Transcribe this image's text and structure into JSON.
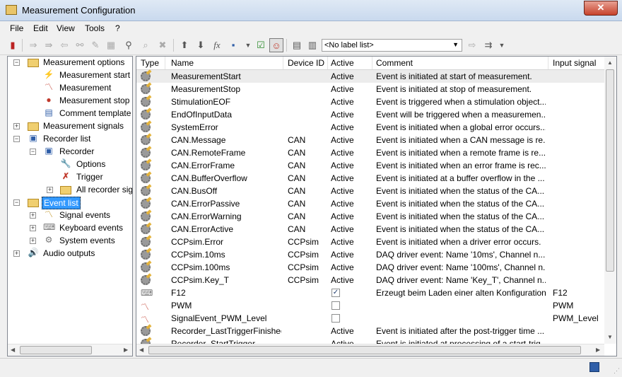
{
  "window": {
    "title": "Measurement Configuration",
    "close_label": "✕"
  },
  "menu": [
    "File",
    "Edit",
    "View",
    "Tools",
    "?"
  ],
  "toolbar": {
    "label_list": "<No label list>"
  },
  "tree": {
    "measurement_options": "Measurement options",
    "measurement_start": "Measurement start",
    "measurement": "Measurement",
    "measurement_stop": "Measurement stop",
    "comment_template": "Comment template",
    "measurement_signals": "Measurement signals",
    "recorder_list": "Recorder list",
    "recorder": "Recorder",
    "options": "Options",
    "trigger": "Trigger",
    "all_recorder_signals": "All recorder sig",
    "event_list": "Event list",
    "signal_events": "Signal events",
    "keyboard_events": "Keyboard events",
    "system_events": "System events",
    "audio_outputs": "Audio outputs"
  },
  "grid": {
    "headers": {
      "type": "Type",
      "name": "Name",
      "device": "Device ID",
      "active": "Active",
      "comment": "Comment",
      "input": "Input signal"
    },
    "rows": [
      {
        "name": "MeasurementStart",
        "device": "",
        "active": "Active",
        "comment": "Event is initiated at start of measurement.",
        "input": "",
        "icon": "gear-icon"
      },
      {
        "name": "MeasurementStop",
        "device": "",
        "active": "Active",
        "comment": "Event is initiated at stop of measurement.",
        "input": "",
        "icon": "gear-icon"
      },
      {
        "name": "StimulationEOF",
        "device": "",
        "active": "Active",
        "comment": "Event is triggered when a stimulation object...",
        "input": "",
        "icon": "gear-icon"
      },
      {
        "name": "EndOfInputData",
        "device": "",
        "active": "Active",
        "comment": "Event will be triggered when a measuremen...",
        "input": "",
        "icon": "gear-icon"
      },
      {
        "name": "SystemError",
        "device": "",
        "active": "Active",
        "comment": "Event is initiated when a global error occurs...",
        "input": "",
        "icon": "gear-icon"
      },
      {
        "name": "CAN.Message",
        "device": "CAN",
        "active": "Active",
        "comment": "Event is initiated when a CAN message is re...",
        "input": "",
        "icon": "gear-icon"
      },
      {
        "name": "CAN.RemoteFrame",
        "device": "CAN",
        "active": "Active",
        "comment": "Event is initiated when a remote frame is re...",
        "input": "",
        "icon": "gear-icon"
      },
      {
        "name": "CAN.ErrorFrame",
        "device": "CAN",
        "active": "Active",
        "comment": "Event is initiated when an error frame is rec...",
        "input": "",
        "icon": "gear-icon"
      },
      {
        "name": "CAN.BufferOverflow",
        "device": "CAN",
        "active": "Active",
        "comment": "Event is initiated at a buffer overflow in the ...",
        "input": "",
        "icon": "gear-icon"
      },
      {
        "name": "CAN.BusOff",
        "device": "CAN",
        "active": "Active",
        "comment": "Event is initiated when the status of the CA...",
        "input": "",
        "icon": "gear-icon"
      },
      {
        "name": "CAN.ErrorPassive",
        "device": "CAN",
        "active": "Active",
        "comment": "Event is initiated when the status of the CA...",
        "input": "",
        "icon": "gear-icon"
      },
      {
        "name": "CAN.ErrorWarning",
        "device": "CAN",
        "active": "Active",
        "comment": "Event is initiated when the status of the CA...",
        "input": "",
        "icon": "gear-icon"
      },
      {
        "name": "CAN.ErrorActive",
        "device": "CAN",
        "active": "Active",
        "comment": "Event is initiated when the status of the CA...",
        "input": "",
        "icon": "gear-icon"
      },
      {
        "name": "CCPsim.Error",
        "device": "CCPsim",
        "active": "Active",
        "comment": "Event is initiated when a driver error occurs.",
        "input": "",
        "icon": "gear-icon"
      },
      {
        "name": "CCPsim.10ms",
        "device": "CCPsim",
        "active": "Active",
        "comment": "DAQ driver event: Name '10ms', Channel n...",
        "input": "",
        "icon": "gear-icon"
      },
      {
        "name": "CCPsim.100ms",
        "device": "CCPsim",
        "active": "Active",
        "comment": "DAQ driver event: Name '100ms', Channel n...",
        "input": "",
        "icon": "gear-icon"
      },
      {
        "name": "CCPsim.Key_T",
        "device": "CCPsim",
        "active": "Active",
        "comment": "DAQ driver event: Name 'Key_T', Channel n...",
        "input": "",
        "icon": "gear-icon"
      },
      {
        "name": "F12",
        "device": "",
        "active": "",
        "checked": true,
        "comment": "Erzeugt beim Laden einer alten Konfiguration",
        "input": "F12",
        "icon": "keyboard-event-icon"
      },
      {
        "name": "PWM",
        "device": "",
        "active": "",
        "checked": false,
        "comment": "",
        "input": "PWM",
        "icon": "signal-event-icon"
      },
      {
        "name": "SignalEvent_PWM_Level",
        "device": "",
        "active": "",
        "checked": false,
        "comment": "",
        "input": "PWM_Level",
        "icon": "signal-event-icon"
      },
      {
        "name": "Recorder_LastTriggerFinished",
        "device": "",
        "active": "Active",
        "comment": "Event is initiated after the post-trigger time ...",
        "input": "",
        "icon": "gear-icon"
      },
      {
        "name": "Recorder_StartTrigger",
        "device": "",
        "active": "Active",
        "comment": "Event is initiated at processing of a start-trig...",
        "input": "",
        "icon": "gear-icon"
      }
    ]
  }
}
